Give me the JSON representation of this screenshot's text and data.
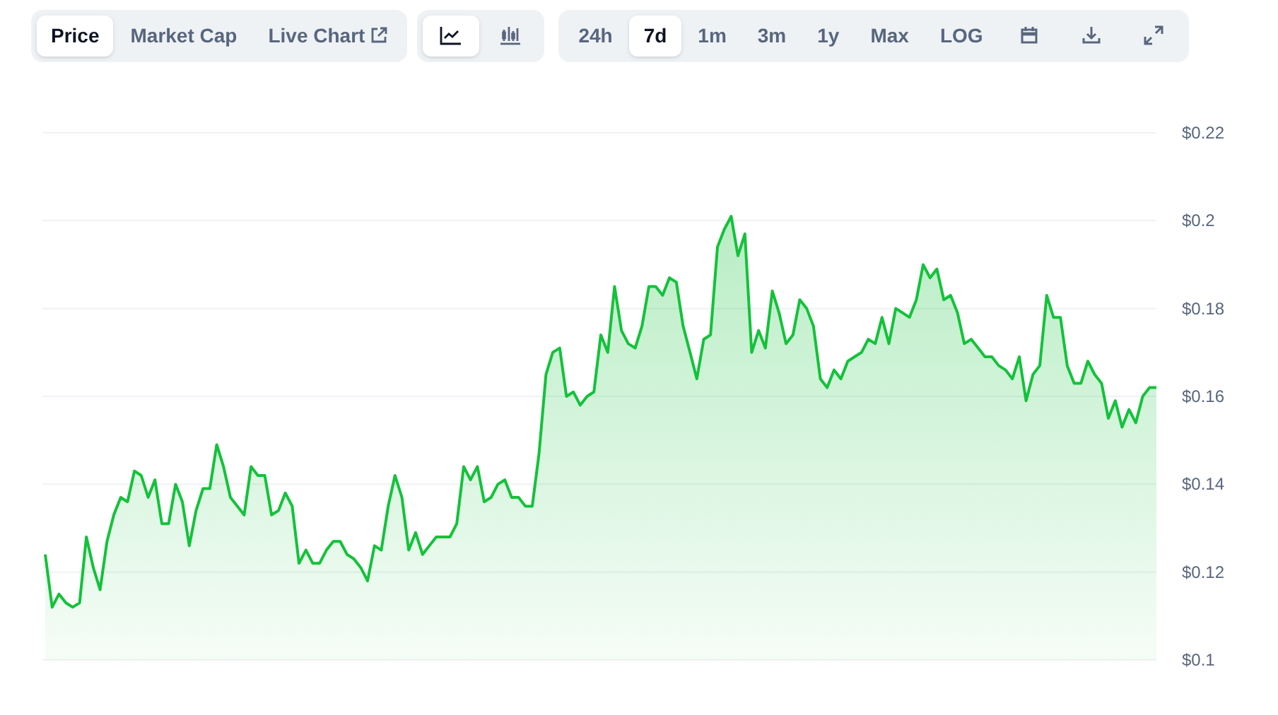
{
  "view_tabs": [
    {
      "label": "Price",
      "selected": true,
      "kind": "plain"
    },
    {
      "label": "Market Cap",
      "selected": false,
      "kind": "plain"
    },
    {
      "label": "Live Chart",
      "selected": false,
      "kind": "external"
    }
  ],
  "chart_types": [
    {
      "kind": "line",
      "selected": true
    },
    {
      "kind": "candlestick",
      "selected": false
    }
  ],
  "ranges": [
    {
      "label": "24h",
      "selected": false
    },
    {
      "label": "7d",
      "selected": true
    },
    {
      "label": "1m",
      "selected": false
    },
    {
      "label": "3m",
      "selected": false
    },
    {
      "label": "1y",
      "selected": false
    },
    {
      "label": "Max",
      "selected": false
    },
    {
      "label": "LOG",
      "selected": false
    }
  ],
  "chart": {
    "chart_data": {
      "type": "area",
      "grid": true,
      "ylim": [
        0.1,
        0.22
      ],
      "yticks": [
        {
          "value": 0.1,
          "label": "$0.1"
        },
        {
          "value": 0.12,
          "label": "$0.12"
        },
        {
          "value": 0.14,
          "label": "$0.14"
        },
        {
          "value": 0.16,
          "label": "$0.16"
        },
        {
          "value": 0.18,
          "label": "$0.18"
        },
        {
          "value": 0.2,
          "label": "$0.2"
        },
        {
          "value": 0.22,
          "label": "$0.22"
        }
      ],
      "series": [
        {
          "color": "#13c23a",
          "values": [
            0.124,
            0.112,
            0.115,
            0.113,
            0.112,
            0.113,
            0.128,
            0.121,
            0.116,
            0.127,
            0.133,
            0.137,
            0.136,
            0.143,
            0.142,
            0.137,
            0.141,
            0.131,
            0.131,
            0.14,
            0.136,
            0.126,
            0.134,
            0.139,
            0.139,
            0.149,
            0.144,
            0.137,
            0.135,
            0.133,
            0.144,
            0.142,
            0.142,
            0.133,
            0.134,
            0.138,
            0.135,
            0.122,
            0.125,
            0.122,
            0.122,
            0.125,
            0.127,
            0.127,
            0.124,
            0.123,
            0.121,
            0.118,
            0.126,
            0.125,
            0.135,
            0.142,
            0.137,
            0.125,
            0.129,
            0.124,
            0.126,
            0.128,
            0.128,
            0.128,
            0.131,
            0.144,
            0.141,
            0.144,
            0.136,
            0.137,
            0.14,
            0.141,
            0.137,
            0.137,
            0.135,
            0.135,
            0.147,
            0.165,
            0.17,
            0.171,
            0.16,
            0.161,
            0.158,
            0.16,
            0.161,
            0.174,
            0.17,
            0.185,
            0.175,
            0.172,
            0.171,
            0.176,
            0.185,
            0.185,
            0.183,
            0.187,
            0.186,
            0.176,
            0.17,
            0.164,
            0.173,
            0.174,
            0.194,
            0.198,
            0.201,
            0.192,
            0.197,
            0.17,
            0.175,
            0.171,
            0.184,
            0.179,
            0.172,
            0.174,
            0.182,
            0.18,
            0.176,
            0.164,
            0.162,
            0.166,
            0.164,
            0.168,
            0.169,
            0.17,
            0.173,
            0.172,
            0.178,
            0.172,
            0.18,
            0.179,
            0.178,
            0.182,
            0.19,
            0.187,
            0.189,
            0.182,
            0.183,
            0.179,
            0.172,
            0.173,
            0.171,
            0.169,
            0.169,
            0.167,
            0.166,
            0.164,
            0.169,
            0.159,
            0.165,
            0.167,
            0.183,
            0.178,
            0.178,
            0.167,
            0.163,
            0.163,
            0.168,
            0.165,
            0.163,
            0.155,
            0.159,
            0.153,
            0.157,
            0.154,
            0.16,
            0.162,
            0.162
          ]
        }
      ]
    }
  }
}
